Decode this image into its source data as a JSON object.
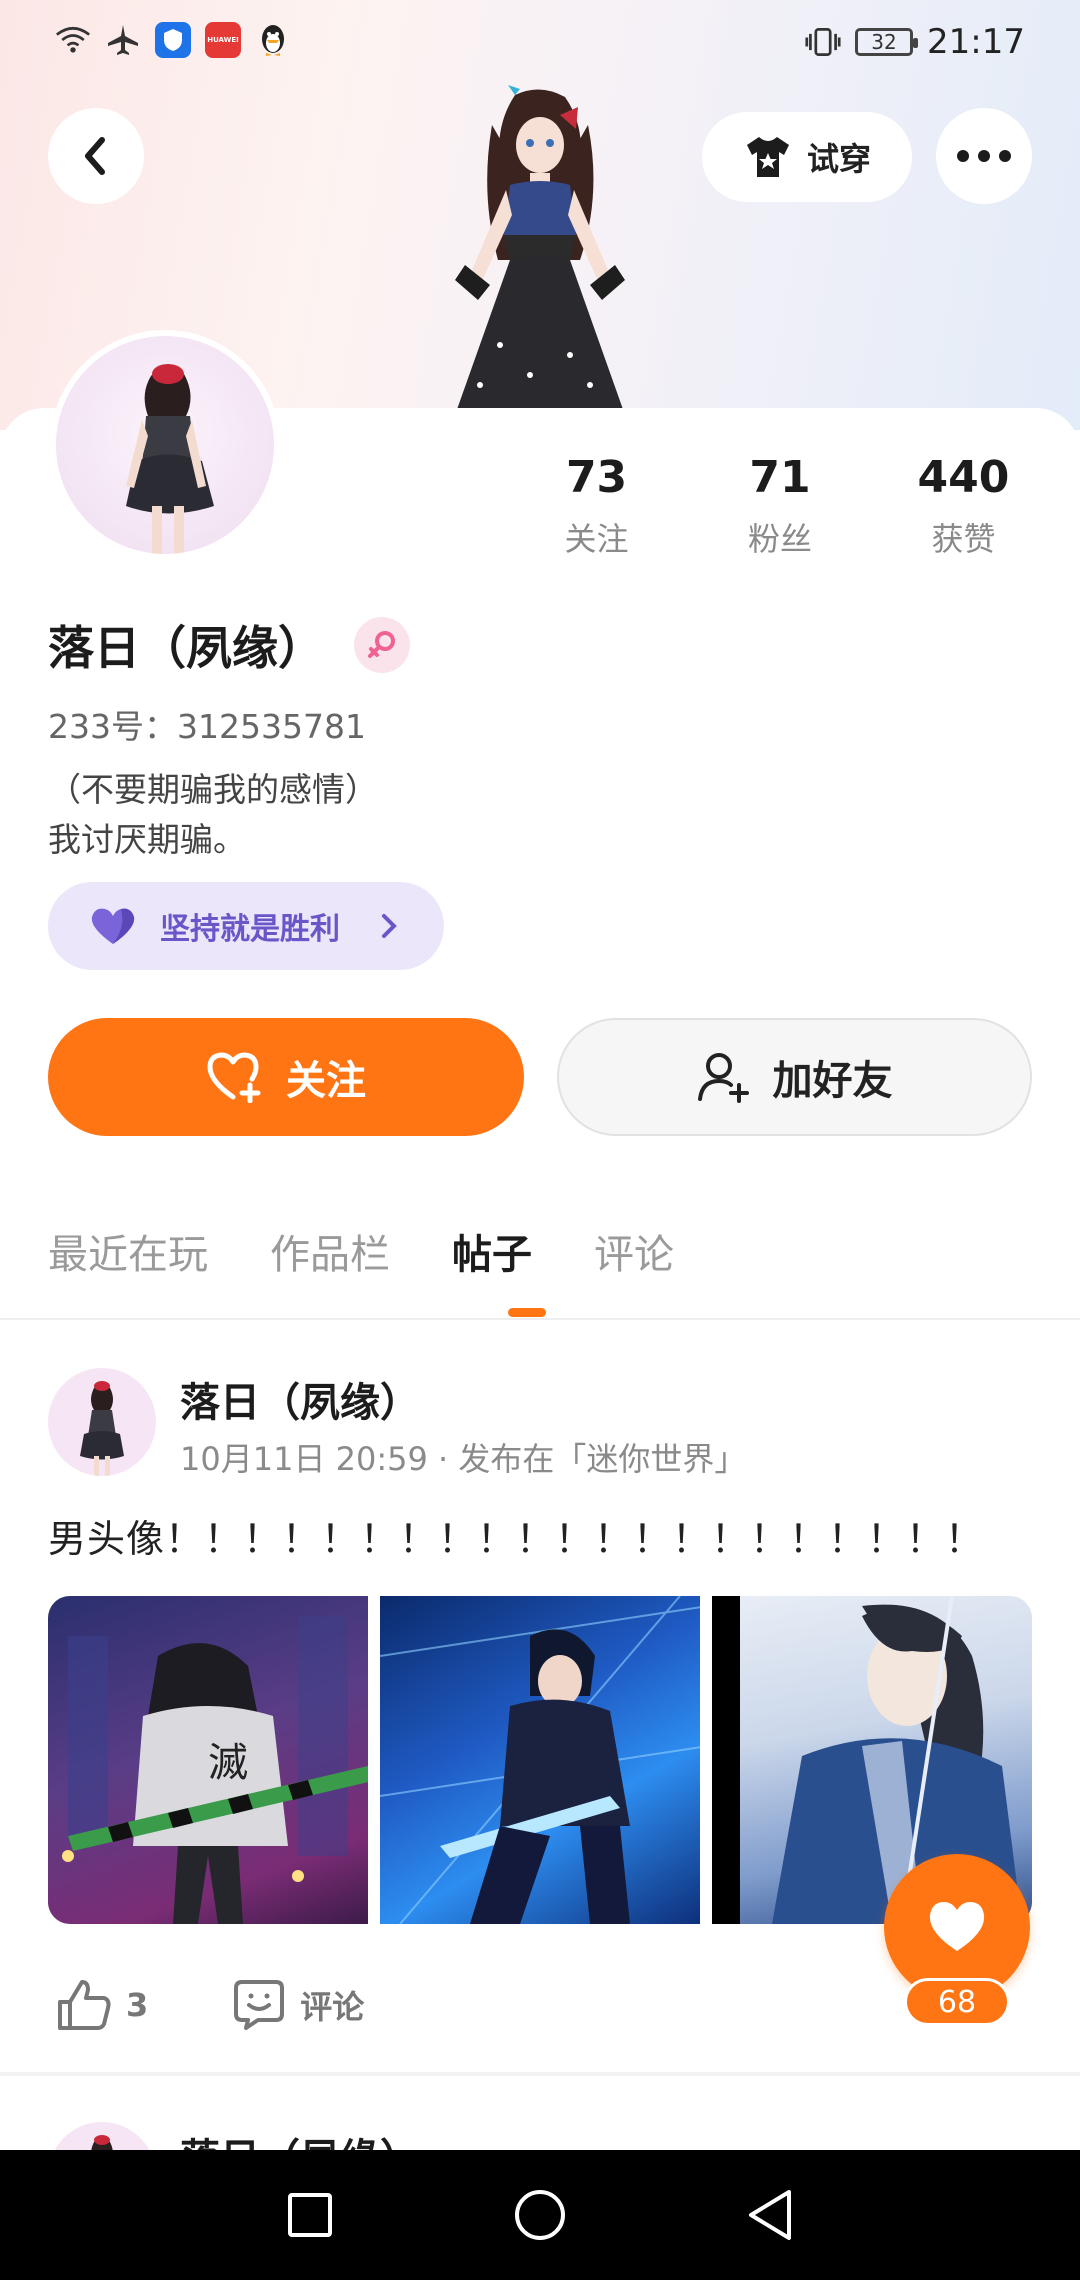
{
  "status_bar": {
    "time": "21:17",
    "battery": "32",
    "huawei_label": "HUAWEI"
  },
  "header": {
    "tryon_label": "试穿"
  },
  "stats": [
    {
      "value": "73",
      "label": "关注"
    },
    {
      "value": "71",
      "label": "粉丝"
    },
    {
      "value": "440",
      "label": "获赞"
    }
  ],
  "profile": {
    "name": "落日（夙缘）",
    "uid": "233号：312535781",
    "bio_line1": "（不要期骗我的感情）",
    "bio_line2": "我讨厌期骗。",
    "tag": "坚持就是胜利"
  },
  "actions": {
    "follow": "关注",
    "add_friend": "加好友"
  },
  "tabs": [
    "最近在玩",
    "作品栏",
    "帖子",
    "评论"
  ],
  "active_tab": "帖子",
  "post": {
    "author": "落日（夙缘）",
    "meta": "10月11日 20:59 · 发布在「迷你世界」",
    "text": "男头像！！！！！！！！！！！！！！！！！！！！！",
    "image_caption": "滅",
    "likes": "3",
    "comment_label": "评论",
    "heart_count": "68"
  },
  "next_post": {
    "author": "落日（夙缘）"
  },
  "colors": {
    "accent": "#ff7413",
    "tag_bg": "#ebe6fa",
    "tag_text": "#6a56c9"
  }
}
